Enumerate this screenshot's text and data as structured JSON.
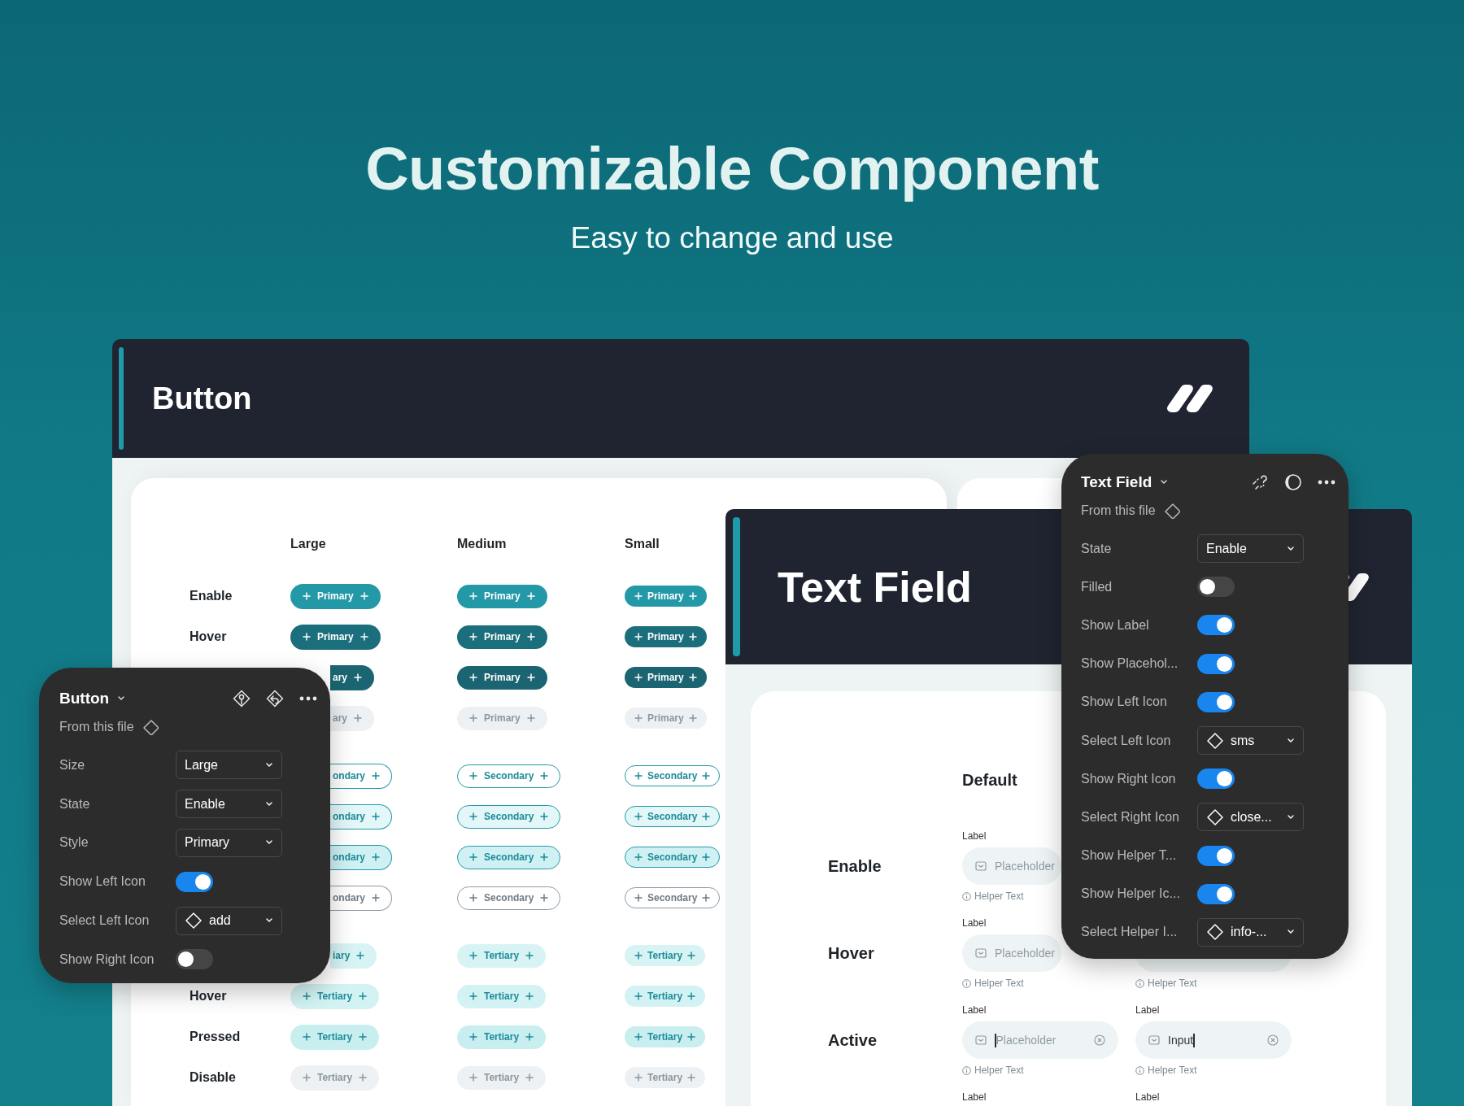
{
  "hero": {
    "title": "Customizable Component",
    "subtitle": "Easy to change and use"
  },
  "button_card": {
    "title": "Button",
    "column_headings": [
      "Large",
      "Medium",
      "Small"
    ],
    "rows": [
      {
        "label": "Enable",
        "kind": "primary",
        "cells": [
          {
            "text": "Primary",
            "partial": false
          },
          {
            "text": "Primary",
            "partial": false
          },
          {
            "text": "Primary",
            "partial": false
          }
        ]
      },
      {
        "label": "Hover",
        "kind": "primary",
        "cells": [
          {
            "text": "Primary",
            "partial": false
          },
          {
            "text": "Primary",
            "partial": false
          },
          {
            "text": "Primary",
            "partial": false
          }
        ]
      },
      {
        "kind": "primary",
        "cells": [
          {
            "text": "ary",
            "partial": true
          },
          {
            "text": "Primary",
            "partial": false
          },
          {
            "text": "Primary",
            "partial": false
          }
        ]
      },
      {
        "kind": "primary",
        "cells": [
          {
            "text": "ary",
            "partial": true
          },
          {
            "text": "Primary",
            "partial": false
          },
          {
            "text": "Primary",
            "partial": false
          }
        ]
      },
      {
        "kind": "secondary",
        "cells": [
          {
            "text": "ondary",
            "partial": true
          },
          {
            "text": "Secondary",
            "partial": false
          },
          {
            "text": "Secondary",
            "partial": false
          }
        ]
      },
      {
        "kind": "secondary",
        "cells": [
          {
            "text": "ondary",
            "partial": true
          },
          {
            "text": "Secondary",
            "partial": false
          },
          {
            "text": "Secondary",
            "partial": false
          }
        ]
      },
      {
        "kind": "secondary",
        "cells": [
          {
            "text": "ondary",
            "partial": true
          },
          {
            "text": "Secondary",
            "partial": false
          },
          {
            "text": "Secondary",
            "partial": false
          }
        ]
      },
      {
        "kind": "secondary",
        "cells": [
          {
            "text": "ondary",
            "partial": true
          },
          {
            "text": "Secondary",
            "partial": false
          },
          {
            "text": "Secondary",
            "partial": false
          }
        ]
      },
      {
        "kind": "tertiary",
        "cells": [
          {
            "text": "iary",
            "partial": true
          },
          {
            "text": "Tertiary",
            "partial": false
          },
          {
            "text": "Tertiary",
            "partial": false
          }
        ]
      },
      {
        "label": "Hover",
        "kind": "tertiary",
        "cells": [
          {
            "text": "Tertiary",
            "partial": false
          },
          {
            "text": "Tertiary",
            "partial": false
          },
          {
            "text": "Tertiary",
            "partial": false
          }
        ]
      },
      {
        "label": "Pressed",
        "kind": "tertiary",
        "cells": [
          {
            "text": "Tertiary",
            "partial": false
          },
          {
            "text": "Tertiary",
            "partial": false
          },
          {
            "text": "Tertiary",
            "partial": false
          }
        ]
      },
      {
        "label": "Disable",
        "kind": "tertiary",
        "cells": [
          {
            "text": "Tertiary",
            "partial": false
          },
          {
            "text": "Tertiary",
            "partial": false
          },
          {
            "text": "Tertiary",
            "partial": false
          }
        ]
      }
    ]
  },
  "text_field_card": {
    "title": "Text Field",
    "column_heading": "Default",
    "rows": [
      {
        "label": "Enable",
        "fields": [
          {
            "label": "Label",
            "placeholder": "Placeholder",
            "helper": "Helper Text",
            "focused": false,
            "partial": true
          }
        ]
      },
      {
        "label": "Hover",
        "fields": [
          {
            "label": "Label",
            "placeholder": "Placeholder",
            "helper": "Helper Text",
            "focused": false,
            "partial": true
          },
          {
            "helper": "Helper Text"
          }
        ]
      },
      {
        "label": "Active",
        "fields": [
          {
            "label": "Label",
            "placeholder": "Placeholder",
            "helper": "Helper Text",
            "clear_icon": true,
            "focused": true
          },
          {
            "label": "Label",
            "value": "Input",
            "helper": "Helper Text",
            "clear_icon": true,
            "focused": true
          }
        ]
      },
      {
        "fields": [
          {
            "label": "Label"
          },
          {
            "label": "Label"
          }
        ]
      }
    ]
  },
  "button_panel": {
    "title": "Button",
    "source": "From this file",
    "rows": [
      {
        "kind": "select",
        "label": "Size",
        "value": "Large"
      },
      {
        "kind": "select",
        "label": "State",
        "value": "Enable"
      },
      {
        "kind": "select",
        "label": "Style",
        "value": "Primary"
      },
      {
        "kind": "toggle",
        "label": "Show Left Icon",
        "on": true
      },
      {
        "kind": "icon-select",
        "label": "Select Left Icon",
        "value": "add"
      },
      {
        "kind": "toggle",
        "label": "Show Right Icon",
        "on": false
      }
    ]
  },
  "text_field_panel": {
    "title": "Text Field",
    "source": "From this file",
    "rows": [
      {
        "kind": "select",
        "label": "State",
        "value": "Enable"
      },
      {
        "kind": "toggle",
        "label": "Filled",
        "on": false
      },
      {
        "kind": "toggle",
        "label": "Show Label",
        "on": true
      },
      {
        "kind": "toggle",
        "label": "Show Placehol...",
        "on": true
      },
      {
        "kind": "toggle",
        "label": "Show Left Icon",
        "on": true
      },
      {
        "kind": "icon-select",
        "label": "Select Left Icon",
        "value": "sms"
      },
      {
        "kind": "toggle",
        "label": "Show Right Icon",
        "on": true
      },
      {
        "kind": "icon-select",
        "label": "Select Right Icon",
        "value": "close..."
      },
      {
        "kind": "toggle",
        "label": "Show Helper T...",
        "on": true
      },
      {
        "kind": "toggle",
        "label": "Show Helper Ic...",
        "on": true
      },
      {
        "kind": "icon-select",
        "label": "Select Helper I...",
        "value": "info-..."
      }
    ]
  }
}
